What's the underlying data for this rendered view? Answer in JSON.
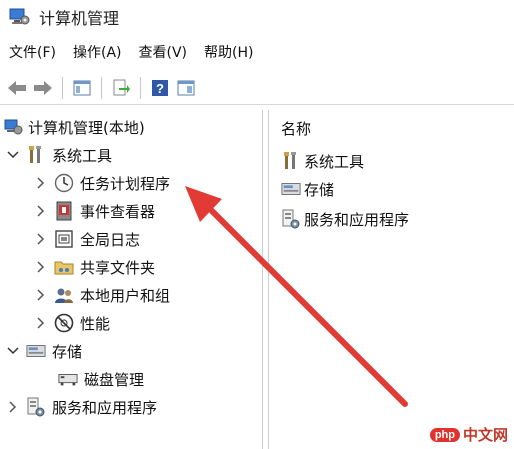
{
  "window": {
    "title": "计算机管理"
  },
  "menu": [
    {
      "label": "文件(F)"
    },
    {
      "label": "操作(A)"
    },
    {
      "label": "查看(V)"
    },
    {
      "label": "帮助(H)"
    }
  ],
  "toolbar": {
    "buttons": [
      "back-arrow-icon",
      "forward-arrow-icon",
      "show-hide-console-tree-icon",
      "export-list-icon",
      "help-icon",
      "properties-icon"
    ]
  },
  "tree": {
    "root": "计算机管理(本地)",
    "system_tools": "系统工具",
    "task_scheduler": "任务计划程序",
    "event_viewer": "事件查看器",
    "global_log": "全局日志",
    "shared_folders": "共享文件夹",
    "local_users": "本地用户和组",
    "performance": "性能",
    "storage": "存储",
    "disk_management": "磁盘管理",
    "services_apps": "服务和应用程序"
  },
  "right_pane": {
    "column_header": "名称",
    "items": [
      "系统工具",
      "存储",
      "服务和应用程序"
    ]
  },
  "watermark": {
    "badge": "php",
    "text": "中文网"
  },
  "colors": {
    "annotation_arrow": "#e23b35",
    "accent_blue": "#2f6db5"
  }
}
